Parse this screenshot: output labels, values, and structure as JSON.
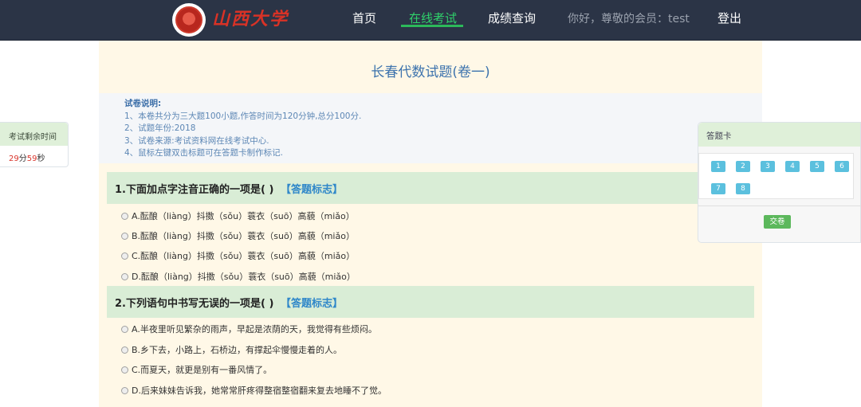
{
  "nav": {
    "logo_text": "山西大学",
    "home": "首页",
    "online_exam": "在线考试",
    "score_query": "成绩查询",
    "greeting": "你好，尊敬的会员：test",
    "logout": "登出"
  },
  "paper": {
    "title": "长春代数试题(卷一)",
    "instructions": {
      "heading": "试卷说明:",
      "lines": [
        "1、本卷共分为三大题100小题,作答时间为120分钟,总分100分.",
        "2、试题年份:2018",
        "3、试卷来源:考试资料网在线考试中心.",
        "4、鼠标左键双击标题可在答题卡制作标记."
      ]
    }
  },
  "questions": [
    {
      "title": "1.下面加点字注音正确的一项是( )",
      "mark_label": "【答题标志】",
      "options": [
        "A.酝酿（liàng）抖擞（sǒu）蓑衣（suō）高藐（miǎo）",
        "B.酝酿（liàng）抖擞（sǒu）蓑衣（suō）高藐（miǎo）",
        "C.酝酿（liàng）抖擞（sǒu）蓑衣（suō）高藐（miǎo）",
        "D.酝酿（liàng）抖擞（sǒu）蓑衣（suō）高藐（miǎo）"
      ]
    },
    {
      "title": "2.下列语句中书写无误的一项是( )",
      "mark_label": "【答题标志】",
      "options": [
        "A.半夜里听见繁杂的雨声，早起是浓荫的天，我觉得有些烦闷。",
        "B.乡下去，小路上，石桥边，有撑起伞慢慢走着的人。",
        "C.而夏天，就更是别有一番风情了。",
        "D.后来妹妹告诉我，她常常肝疼得整宿整宿翻来复去地睡不了觉。"
      ]
    }
  ],
  "timer": {
    "label": "考试剩余时间",
    "minutes": "29",
    "min_unit": "分",
    "seconds": "59",
    "sec_unit": "秒"
  },
  "answer_card": {
    "title": "答题卡",
    "numbers": [
      "1",
      "2",
      "3",
      "4",
      "5",
      "6",
      "7",
      "8"
    ],
    "submit_label": "交卷",
    "cell_color": "#5bc0de",
    "submit_color": "#5cb85c"
  }
}
